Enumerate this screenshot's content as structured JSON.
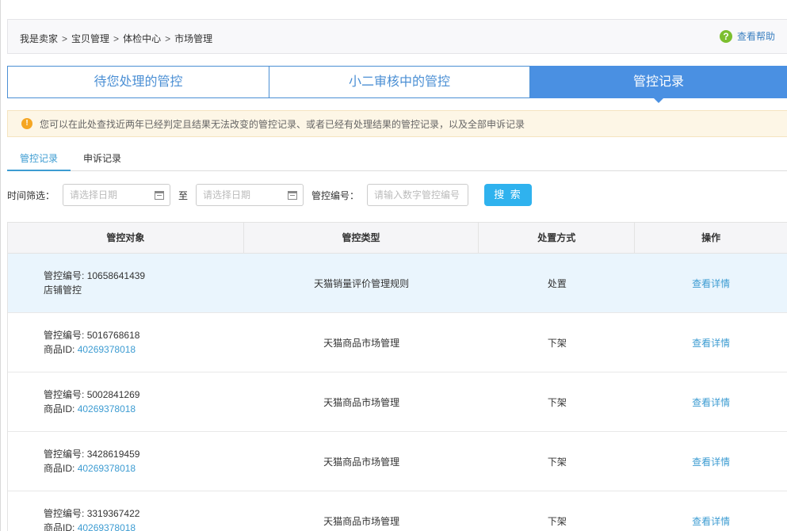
{
  "breadcrumb": [
    "我是卖家",
    "宝贝管理",
    "体检中心",
    "市场管理"
  ],
  "breadcrumb_separator": ">",
  "help_label": "查看帮助",
  "main_tabs": [
    "待您处理的管控",
    "小二审核中的管控",
    "管控记录"
  ],
  "active_main_tab": "管控记录",
  "notice": "您可以在此处查找近两年已经判定且结果无法改变的管控记录、或者已经有处理结果的管控记录，以及全部申诉记录",
  "sub_tabs": [
    "管控记录",
    "申诉记录"
  ],
  "filter": {
    "time_label": "时间筛选：",
    "start_placeholder": "请选择日期",
    "to_label": "至",
    "end_placeholder": "请选择日期",
    "id_label": "管控编号：",
    "id_placeholder": "请输入数字管控编号",
    "search_label": "搜 索"
  },
  "table": {
    "headers": [
      "管控对象",
      "管控类型",
      "处置方式",
      "操作"
    ],
    "rows": [
      {
        "id_label": "管控编号:",
        "id": "10658641439",
        "sub_label": "店铺管控",
        "sub_value": "",
        "type": "天猫销量评价管理规则",
        "action": "处置",
        "op": "查看详情"
      },
      {
        "id_label": "管控编号:",
        "id": "5016768618",
        "sub_label": "商品ID:",
        "sub_value": "40269378018",
        "type": "天猫商品市场管理",
        "action": "下架",
        "op": "查看详情"
      },
      {
        "id_label": "管控编号:",
        "id": "5002841269",
        "sub_label": "商品ID:",
        "sub_value": "40269378018",
        "type": "天猫商品市场管理",
        "action": "下架",
        "op": "查看详情"
      },
      {
        "id_label": "管控编号:",
        "id": "3428619459",
        "sub_label": "商品ID:",
        "sub_value": "40269378018",
        "type": "天猫商品市场管理",
        "action": "下架",
        "op": "查看详情"
      },
      {
        "id_label": "管控编号:",
        "id": "3319367422",
        "sub_label": "商品ID:",
        "sub_value": "40269378018",
        "type": "天猫商品市场管理",
        "action": "下架",
        "op": "查看详情"
      }
    ]
  },
  "colors": {
    "primary": "#4a90e2",
    "link": "#3d9cd2",
    "search_button": "#2fb2ee",
    "notice_bg": "#fdf6e6",
    "row_highlight": "#eaf5fd"
  }
}
